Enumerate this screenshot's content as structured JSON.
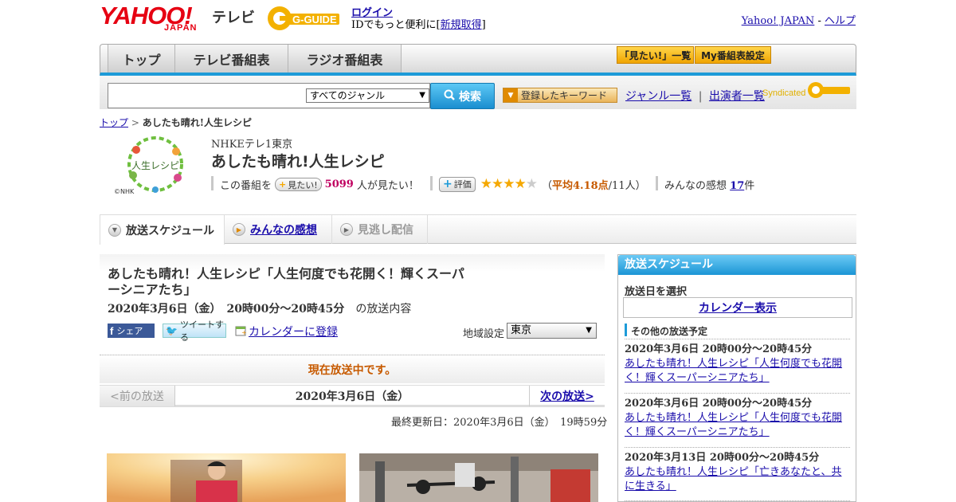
{
  "header": {
    "logo_text": "YAHOO!",
    "logo_sub": "JAPAN",
    "service_name": "テレビ",
    "gguide_logo": "G-GUIDE",
    "login_label": "ログイン",
    "login_sub_prefix": "IDでもっと便利に[",
    "signup_label": "新規取得",
    "login_sub_suffix": "]",
    "yahoo_japan_link": "Yahoo! JAPAN",
    "separator": " - ",
    "help_link": "ヘルプ"
  },
  "nav": {
    "tabs": [
      "トップ",
      "テレビ番組表",
      "ラジオ番組表"
    ],
    "want_list_label": "「見たい!」一覧",
    "my_schedule_label": "My番組表設定"
  },
  "search": {
    "placeholder": "",
    "genre_selected": "すべてのジャンル",
    "search_button": "検索",
    "keyword_button": "登録したキーワード",
    "genre_list_link": "ジャンル一覧",
    "link_sep": "|",
    "performer_list_link": "出演者一覧",
    "syndicated_label": "Syndicated"
  },
  "breadcrumb": {
    "home": "トップ",
    "sep": " > ",
    "current": "あしたも晴れ!人生レシピ"
  },
  "program": {
    "image_caption": "©NHK",
    "image_text": "人生レシピ",
    "channel": "NHKEテレ1東京",
    "title": "あしたも晴れ!人生レシピ",
    "watch_prefix": "この番組を",
    "want_button": "見たい!",
    "want_count": "5099",
    "want_suffix": "人が見たい！",
    "rate_button": "評価",
    "rating_open": "（",
    "rating_label": "平均4.18点",
    "rating_count": "/11人）",
    "rating_value": 4.18,
    "reviews_prefix": "みんなの感想",
    "reviews_count": "17",
    "reviews_suffix": "件"
  },
  "tabs": {
    "schedule": "放送スケジュール",
    "reviews": "みんなの感想",
    "catchup": "見逃し配信"
  },
  "episode": {
    "title": "あしたも晴れ！人生レシピ「人生何度でも花開く！輝くスーパーシニアたち」",
    "date": "2020年3月6日（金）　20時00分～20時45分",
    "date_suffix": "の放送内容",
    "share_fb": "シェア",
    "share_tw": "ツイートする",
    "calendar_link": "カレンダーに登録",
    "region_label": "地域設定",
    "region_value": "東京",
    "on_air": "現在放送中です。",
    "prev_label": "<前の放送",
    "current_date": "2020年3月6日（金）",
    "next_label": "次の放送>",
    "updated": "最終更新日：2020年3月6日（金）　19時59分"
  },
  "sidebar": {
    "heading": "放送スケジュール",
    "select_label": "放送日を選択",
    "calendar_button": "カレンダー表示",
    "other_label": "その他の放送予定",
    "items": [
      {
        "date": "2020年3月6日 20時00分～20時45分",
        "title": "あしたも晴れ！人生レシピ「人生何度でも花開く！輝くスーパーシニアたち」"
      },
      {
        "date": "2020年3月6日 20時00分～20時45分",
        "title": "あしたも晴れ！人生レシピ「人生何度でも花開く！輝くスーパーシニアたち」"
      },
      {
        "date": "2020年3月13日 20時00分～20時45分",
        "title": "あしたも晴れ！人生レシピ「亡きあなたと、共に生きる」"
      }
    ]
  },
  "colors": {
    "accent_blue": "#1d9bd8",
    "brand_red": "#e60012",
    "onair_orange": "#c75a00",
    "want_pink": "#c00060",
    "star_gold": "#f5a800"
  },
  "icons": [
    "search-icon",
    "star-icon",
    "plus-icon",
    "facebook-icon",
    "twitter-icon",
    "calendar-icon",
    "play-circle-icon",
    "chevron-down-icon"
  ]
}
